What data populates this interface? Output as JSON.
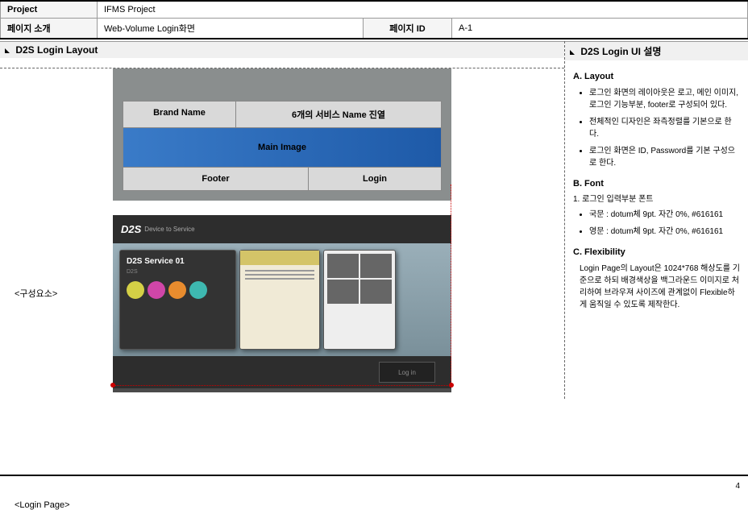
{
  "header": {
    "project_label": "Project",
    "project_value": "IFMS Project",
    "pageintro_label": "페이지 소개",
    "pageintro_value": "Web-Volume Login화면",
    "pageid_label": "페이지 ID",
    "pageid_value": "A-1"
  },
  "left_section_title": "D2S Login Layout",
  "right_section_title": "D2S Login UI 설명",
  "layout_diagram": {
    "brand_name": "Brand Name",
    "services_name": "6개의 서비스 Name 진열",
    "main_image": "Main Image",
    "footer": "Footer",
    "login": "Login"
  },
  "side_labels": {
    "components": "<구성요소>",
    "login_page": "<Login Page>"
  },
  "preview": {
    "logo": "D2S",
    "logo_sub": "Device to Service",
    "card1_title": "D2S Service 01",
    "card1_sub": "D2S",
    "login_text": "Log in"
  },
  "desc": {
    "a_head": "A.  Layout",
    "a_items": [
      "로그인 화면의 레이아웃은 로고, 메인 이미지, 로그인 기능부분, footer로 구성되어 있다.",
      "전체적인 디자인은 좌측정렬를 기본으로 한다.",
      "로그인 화면은 ID, Password를 기본 구성으로 한다."
    ],
    "b_head": "B.  Font",
    "b_intro": "1. 로그인 입력부분 폰트",
    "b_items": [
      "국문 : dotum체 9pt. 자간 0%, #616161",
      "영문 : dotum체 9pt. 자간 0%, #616161"
    ],
    "c_head": "C.  Flexibility",
    "c_text": "Login Page의 Layout은 1024*768 해상도를 기준으로 하되 배경색상을 백그라운드 이미지로 처리하여 브라우져 사이즈에 관계없이 Flexible하게 움직일 수 있도록 제작한다."
  },
  "page_number": "4"
}
